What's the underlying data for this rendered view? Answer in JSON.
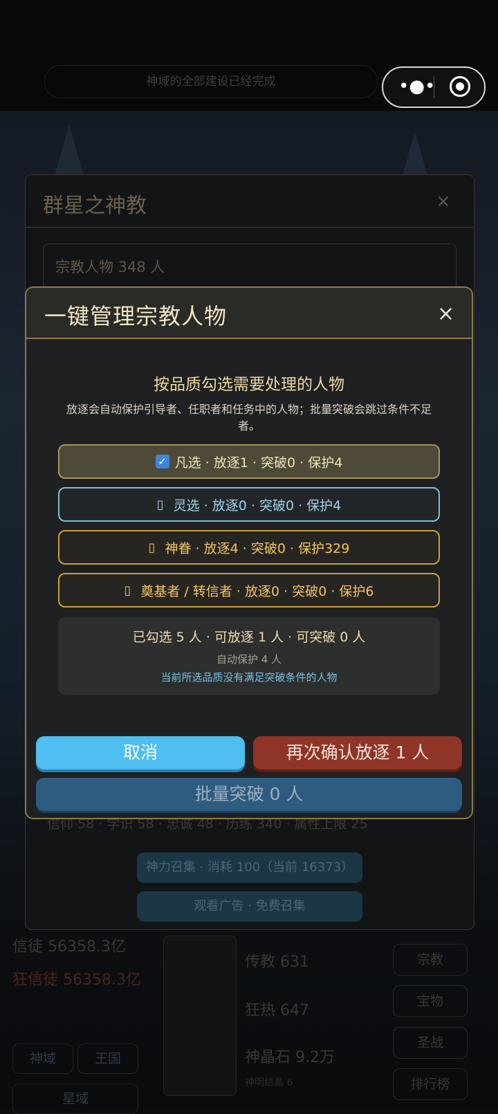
{
  "top": {
    "banner_text": "神域的全部建设已经完成",
    "more_icon": "more-dots-icon",
    "record_icon": "record-circle-icon"
  },
  "sect_panel": {
    "title": "群星之神教",
    "close": "×",
    "member_count": "宗教人物 348 人",
    "attributes": "信仰 58 · 学识 58 · 忠诚 48 · 历练 340 · 属性上限 25",
    "summon_button": "神力召集 · 消耗 100（当前 16373）",
    "watch_ad_button": "观看广告 · 免费召集"
  },
  "background": {
    "believers": "信徒 56358.3亿",
    "zealots": "狂信徒 56358.3亿",
    "missionary": "传教 631",
    "fanatic": "狂热 647",
    "crystal": "神晶石 9.2万",
    "crystal_sub": "神明结晶 6",
    "side_buttons": [
      "宗教",
      "宝物",
      "圣战",
      "排行榜"
    ],
    "bottom_buttons": [
      "神域",
      "王国",
      "星域"
    ]
  },
  "modal": {
    "title": "一键管理宗教人物",
    "close": "×",
    "subtitle": "按品质勾选需要处理的人物",
    "description": "放逐会自动保护引导者、任职者和任务中的人物；批量突破会跳过条件不足者。",
    "options": [
      {
        "label": "凡选 · 放逐1 · 突破0 · 保护4",
        "checked": true,
        "color": "#a39560"
      },
      {
        "label": "灵选 · 放逐0 · 突破0 · 保护4",
        "checked": false,
        "color": "#7fbfd8"
      },
      {
        "label": "神眷 · 放逐4 · 突破0 · 保护329",
        "checked": false,
        "color": "#c9a13e"
      },
      {
        "label": "奠基者 / 转信者 · 放逐0 · 突破0 · 保护6",
        "checked": false,
        "color": "#c9a13e"
      }
    ],
    "summary": {
      "main": "已勾选 5 人 · 可放逐 1 人 · 可突破 0 人",
      "protected": "自动保护 4 人",
      "note": "当前所选品质没有满足突破条件的人物"
    },
    "cancel_button": "取消",
    "confirm_button": "再次确认放逐 1 人",
    "breakthrough_button": "批量突破 0 人"
  }
}
